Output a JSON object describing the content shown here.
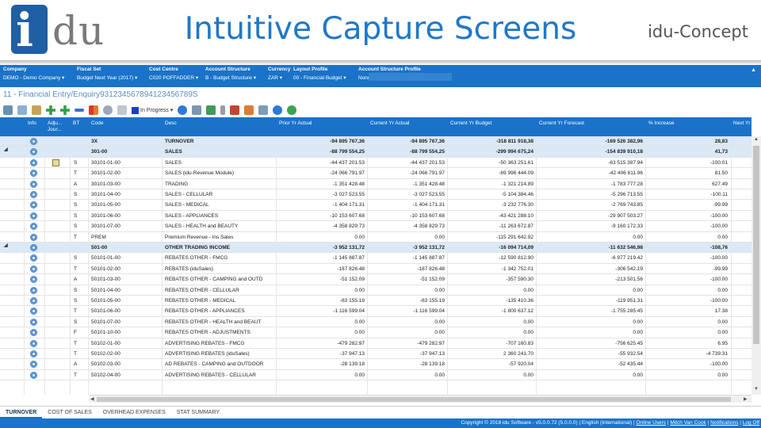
{
  "banner": {
    "logo_i": "i",
    "logo_du": "du",
    "title": "Intuitive Capture Screens",
    "brand": "idu-Concept"
  },
  "filters": [
    {
      "label": "Company",
      "value": "DEMO - Demo Company"
    },
    {
      "label": "Fiscal Set",
      "value": "Budget Next Year (2017)"
    },
    {
      "label": "Cost Centre",
      "value": "C020 POFFADDER"
    },
    {
      "label": "Account Structure",
      "value": "B - Budget Structure"
    },
    {
      "label": "Currency",
      "value": "ZAR"
    },
    {
      "label": "Layout Profile",
      "value": "00 - Financial Budget"
    },
    {
      "label": "Account Structure Profile",
      "value": "None"
    }
  ],
  "breadcrumb": "11 - Financial Entry/Enquiry931234567894123456789S",
  "toolbar": {
    "progress_label": "In Progress"
  },
  "grid": {
    "columns": [
      "Info",
      "Adju... Jour...",
      "BT",
      "Code",
      "Desc",
      "Prior Yr Actual",
      "Current Yr Actual",
      "Current Yr Budget",
      "Current Yr Forecast",
      "% Increase",
      "Next Yr"
    ],
    "rows": [
      {
        "group": true,
        "exp": "",
        "bt": "",
        "code": "3X",
        "desc": "TURNOVER",
        "pya": "-94 895 767,36",
        "cya": "-94 895 767,36",
        "cyb": "-318 811 918,38",
        "cyf": "-169 526 382,96",
        "inc": "28,83"
      },
      {
        "group": true,
        "exp": "◢",
        "bt": "",
        "code": "301-00",
        "desc": "SALES",
        "pya": "-88 799 554,25",
        "cya": "-88 799 554,25",
        "cyb": "-299 994 675,24",
        "cyf": "-154 839 910,18",
        "inc": "41,73"
      },
      {
        "bt": "S",
        "adj": true,
        "code": "30101-01-00",
        "desc": "SALES",
        "pya": "-44 437 201.53",
        "cya": "-44 437 201.53",
        "cyb": "-50 363 251.61",
        "cyf": "-63 515 387.94",
        "inc": "-100.01"
      },
      {
        "bt": "T",
        "code": "30101-02-00",
        "desc": "SALES (idu-Revenue Module)",
        "pya": "-24 066 791.97",
        "cya": "-24 066 791.97",
        "cyb": "-69 996 444.09",
        "cyf": "-42 406 611.96",
        "inc": "81.50"
      },
      {
        "bt": "A",
        "code": "30101-03-00",
        "desc": "TRADING",
        "pya": "-1 351 428.48",
        "cya": "-1 351 428.48",
        "cyb": "-1 321 214.89",
        "cyf": "-1 783 777.28",
        "inc": "627.49"
      },
      {
        "bt": "S",
        "code": "30101-04-00",
        "desc": "SALES - CELLULAR",
        "pya": "-3 027 523.55",
        "cya": "-3 027 523.55",
        "cyb": "-5 104 384.46",
        "cyf": "-5 296 713.55",
        "inc": "-100.11"
      },
      {
        "bt": "S",
        "code": "30101-05-00",
        "desc": "SALES - MEDICAL",
        "pya": "-1 404 171.31",
        "cya": "-1 404 171.31",
        "cyb": "-3 232 776.30",
        "cyf": "-2 769 743.85",
        "inc": "-99.99"
      },
      {
        "bt": "S",
        "code": "30101-06-00",
        "desc": "SALES - APPLIANCES",
        "pya": "-10 153 607.68",
        "cya": "-10 153 607.68",
        "cyb": "-43 421 288.10",
        "cyf": "-29 907 503.27",
        "inc": "-100.00"
      },
      {
        "bt": "S",
        "code": "30101-07-00",
        "desc": "SALES - HEALTH and BEAUTY",
        "pya": "-4 358 829.73",
        "cya": "-4 358 829.73",
        "cyb": "-11 263 672.87",
        "cyf": "-9 160 172.33",
        "inc": "-100.00"
      },
      {
        "bt": "T",
        "code": "PREM",
        "desc": "Premium Revenue - Ins Sales",
        "pya": "0.00",
        "cya": "0.00",
        "cyb": "-115 291 642.92",
        "cyf": "0.00",
        "inc": "0.00"
      },
      {
        "group": true,
        "exp": "◢",
        "bt": "",
        "code": "501-00",
        "desc": "OTHER TRADING INCOME",
        "pya": "-3 952 131,72",
        "cya": "-3 952 131,72",
        "cyb": "-16 094 714,09",
        "cyf": "-11 632 546,98",
        "inc": "-108,76"
      },
      {
        "bt": "S",
        "code": "50101-01-00",
        "desc": "REBATES OTHER - FMCG",
        "pya": "-1 145 887.87",
        "cya": "-1 145 887.87",
        "cyb": "-12 590 812.90",
        "cyf": "-6 977 219.42",
        "inc": "-100.00"
      },
      {
        "bt": "T",
        "code": "50101-02-00",
        "desc": "REBATES (iduSales)",
        "pya": "-187 826.48",
        "cya": "-187 826.48",
        "cyb": "-1 342 752.01",
        "cyf": "-306 542.19",
        "inc": "-99.99"
      },
      {
        "bt": "A",
        "code": "50101-03-00",
        "desc": "REBATES OTHER - CAMPING and OUTD",
        "pya": "-51 152.09",
        "cya": "-51 152.09",
        "cyb": "-357 590.30",
        "cyf": "-213 501.56",
        "inc": "-100.00"
      },
      {
        "bt": "S",
        "code": "50101-04-00",
        "desc": "REBATES OTHER - CELLULAR",
        "pya": "0.00",
        "cya": "0.00",
        "cyb": "0.00",
        "cyf": "0.00",
        "inc": "0.00"
      },
      {
        "bt": "S",
        "code": "50101-05-00",
        "desc": "REBATES OTHER - MEDICAL",
        "pya": "-63 155.19",
        "cya": "-63 155.19",
        "cyb": "-135 410.36",
        "cyf": "-119 951.31",
        "inc": "-100.00"
      },
      {
        "bt": "T",
        "code": "50101-06-00",
        "desc": "REBATES OTHER - APPLIANCES",
        "pya": "-1 116 599.04",
        "cya": "-1 116 599.04",
        "cyb": "-1 800 637.12",
        "cyf": "-1 755 285.45",
        "inc": "17.38"
      },
      {
        "bt": "S",
        "code": "50101-07-00",
        "desc": "REBATES OTHER - HEALTH and BEAUT",
        "pya": "0.00",
        "cya": "0.00",
        "cyb": "0.00",
        "cyf": "0.00",
        "inc": "0.00"
      },
      {
        "bt": "F",
        "code": "50101-10-00",
        "desc": "REBATES OTHER - ADJUSTMENTS",
        "pya": "0.00",
        "cya": "0.00",
        "cyb": "0.00",
        "cyf": "0.00",
        "inc": "0.00"
      },
      {
        "bt": "T",
        "code": "50102-01-00",
        "desc": "ADVERTISING REBATES - FMCG",
        "pya": "-479 282.97",
        "cya": "-479 282.97",
        "cyb": "-707 160.83",
        "cyf": "-756 625.45",
        "inc": "6.95"
      },
      {
        "bt": "T",
        "code": "50102-02-00",
        "desc": "ADVERTISING REBATES (iduSales)",
        "pya": "-37 947.13",
        "cya": "-37 947.13",
        "cyb": "2 360 241.70",
        "cyf": "-55 932.54",
        "inc": "-4 739.31"
      },
      {
        "bt": "A",
        "code": "50102-03-00",
        "desc": "AD REBATES - CAMPING and OUTDOOR",
        "pya": "-28 139.18",
        "cya": "-28 139.18",
        "cyb": "-57 920.04",
        "cyf": "-52 435.44",
        "inc": "-100.00"
      },
      {
        "bt": "T",
        "code": "50102-04-00",
        "desc": "ADVERTISING REBATES - CELLULAR",
        "pya": "0.00",
        "cya": "0.00",
        "cyb": "0.00",
        "cyf": "0.00",
        "inc": "0.00"
      }
    ]
  },
  "tabs": [
    "TURNOVER",
    "COST OF SALES",
    "OVERHEAD EXPENSES",
    "STAT SUMMARY"
  ],
  "footer": {
    "copyright": "Copyright © 2018 idu Software - v5.0.0.72 (5.0.0.0) | English (International) |",
    "links": [
      "Online Users",
      "Mitch Van Cook",
      "Notifications",
      "Log Off"
    ]
  },
  "colors": {
    "accent": "#1a73c9",
    "group_row": "#dbe8f6",
    "title": "#1f78c8"
  }
}
